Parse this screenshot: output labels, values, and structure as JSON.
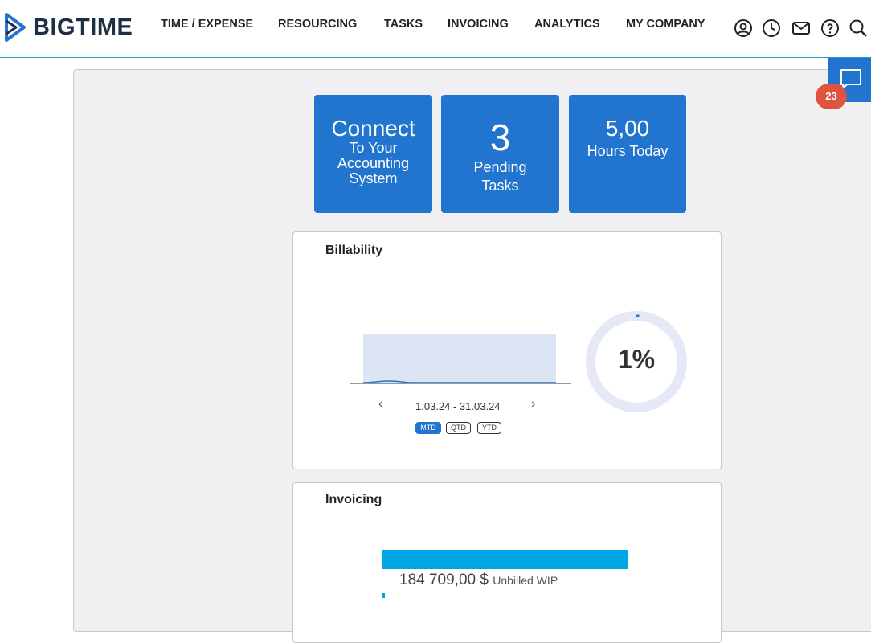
{
  "brand": {
    "name": "BIGTIME",
    "primary_color": "#2175cf",
    "accent_color": "#1f9ad6"
  },
  "nav": {
    "items": [
      {
        "label": "TIME / EXPENSE"
      },
      {
        "label": "RESOURCING"
      },
      {
        "label": "TASKS"
      },
      {
        "label": "INVOICING"
      },
      {
        "label": "ANALYTICS"
      },
      {
        "label": "MY COMPANY"
      }
    ],
    "icons": [
      "user-icon",
      "clock-icon",
      "mail-icon",
      "help-icon",
      "search-icon"
    ]
  },
  "tiles": {
    "connect": {
      "line1": "Connect",
      "line2": "To Your",
      "line3": "Accounting",
      "line4": "System"
    },
    "tasks": {
      "value": "3",
      "line1": "Pending",
      "line2": "Tasks"
    },
    "hours": {
      "value": "5,00",
      "label": "Hours Today"
    }
  },
  "billability": {
    "title": "Billability",
    "date_range": "1.03.24 - 31.03.24",
    "prev_symbol": "‹",
    "next_symbol": "›",
    "periods": [
      {
        "label": "MTD",
        "active": true
      },
      {
        "label": "QTD",
        "active": false
      },
      {
        "label": "YTD",
        "active": false
      }
    ],
    "percent_label": "1%",
    "percent_value": 1,
    "colors": {
      "ring_track": "#e4e9f5",
      "ring_fill": "#2175cf",
      "area": "#dce5f3"
    }
  },
  "invoicing": {
    "title": "Invoicing",
    "amount": "184 709,00 $",
    "amount_label": "Unbilled WIP",
    "bar_color": "#00a6e4"
  },
  "chat": {
    "badge_count": "23",
    "icon": "chat-icon",
    "badge_color": "#e0533f"
  }
}
